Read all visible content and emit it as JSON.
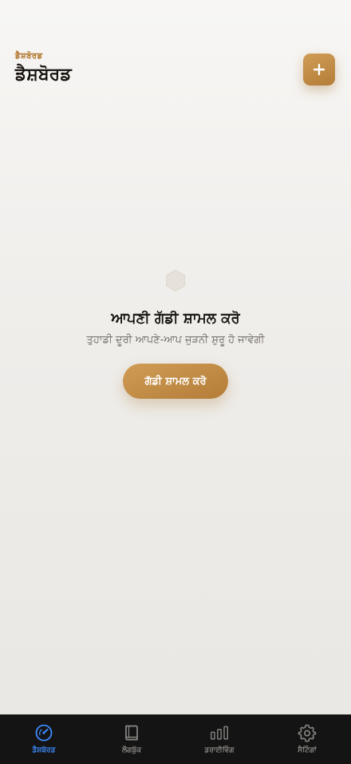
{
  "header": {
    "eyebrow": "ਡੈਸ਼ਬੋਰਡ",
    "title": "ਡੈਸ਼ਬੋਰਡ",
    "add_icon": "plus-icon"
  },
  "empty_state": {
    "icon": "hexagon-icon",
    "title": "ਆਪਣੀ ਗੱਡੀ ਸ਼ਾਮਲ ਕਰੋ",
    "subtitle": "ਤੁਹਾਡੀ ਦੂਰੀ ਆਪਣੇ-ਆਪ ਜੁੜਨੀ ਸ਼ੁਰੂ ਹੋ ਜਾਵੇਗੀ",
    "button_label": "ਗੱਡੀ ਸ਼ਾਮਲ ਕਰੋ"
  },
  "tabbar": {
    "tabs": [
      {
        "label": "ਡੈਸ਼ਬੋਰਡ",
        "icon": "speedometer-icon",
        "active": true
      },
      {
        "label": "ਲੌਗਬੁੱਕ",
        "icon": "book-icon",
        "active": false
      },
      {
        "label": "ਡਰਾਈਵਿੰਗ",
        "icon": "bar-chart-icon",
        "active": false
      },
      {
        "label": "ਸੈਟਿੰਗਾਂ",
        "icon": "gear-icon",
        "active": false
      }
    ]
  },
  "colors": {
    "accent": "#c38b45",
    "active_tab": "#3d8bff",
    "tabbar_bg": "#141414"
  }
}
